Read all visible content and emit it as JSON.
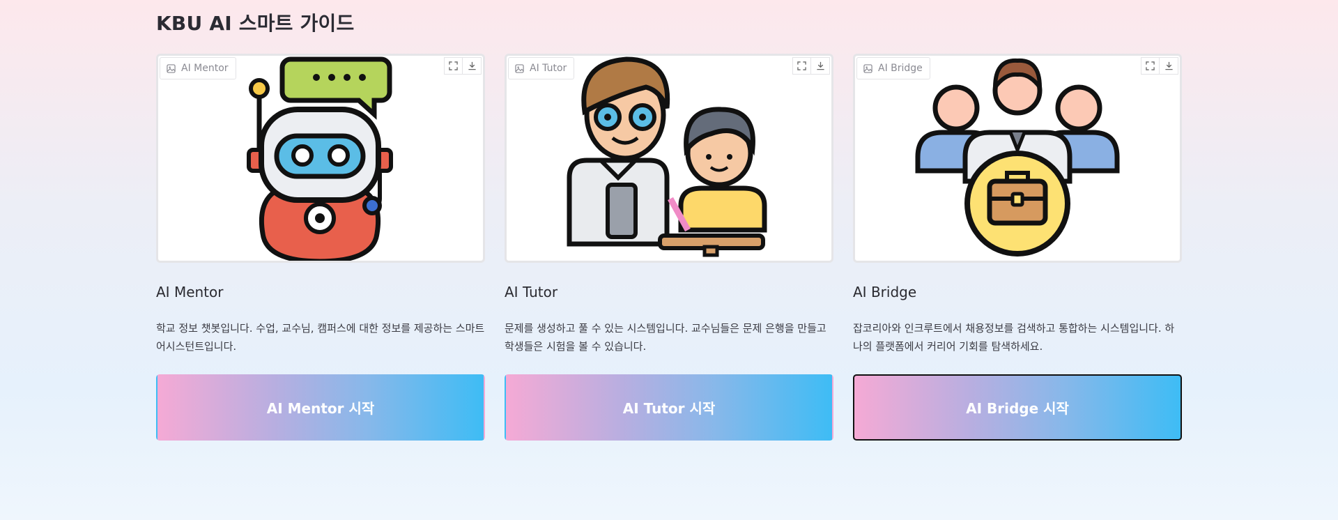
{
  "page": {
    "title": "KBU AI 스마트 가이드"
  },
  "cards": [
    {
      "tag": "AI Mentor",
      "title": "AI Mentor",
      "description": "학교 정보 챗봇입니다. 수업, 교수님, 캠퍼스에 대한 정보를 제공하는 스마트 어시스턴트입니다.",
      "button": "AI Mentor 시작"
    },
    {
      "tag": "AI Tutor",
      "title": "AI Tutor",
      "description": "문제를 생성하고 풀 수 있는 시스템입니다. 교수님들은 문제 은행을 만들고 학생들은 시험을 볼 수 있습니다.",
      "button": "AI Tutor 시작"
    },
    {
      "tag": "AI Bridge",
      "title": "AI Bridge",
      "description": "잡코리아와 인크루트에서 채용정보를 검색하고 통합하는 시스템입니다. 하나의 플랫폼에서 커리어 기회를 탐색하세요.",
      "button": "AI Bridge 시작"
    }
  ],
  "icons": {
    "image_tag": "image-icon",
    "fullscreen": "fullscreen-icon",
    "download": "download-icon"
  },
  "colors": {
    "button_gradient_start": "#f5aad5",
    "button_gradient_end": "#3ebcf5",
    "outline": "#111111"
  }
}
